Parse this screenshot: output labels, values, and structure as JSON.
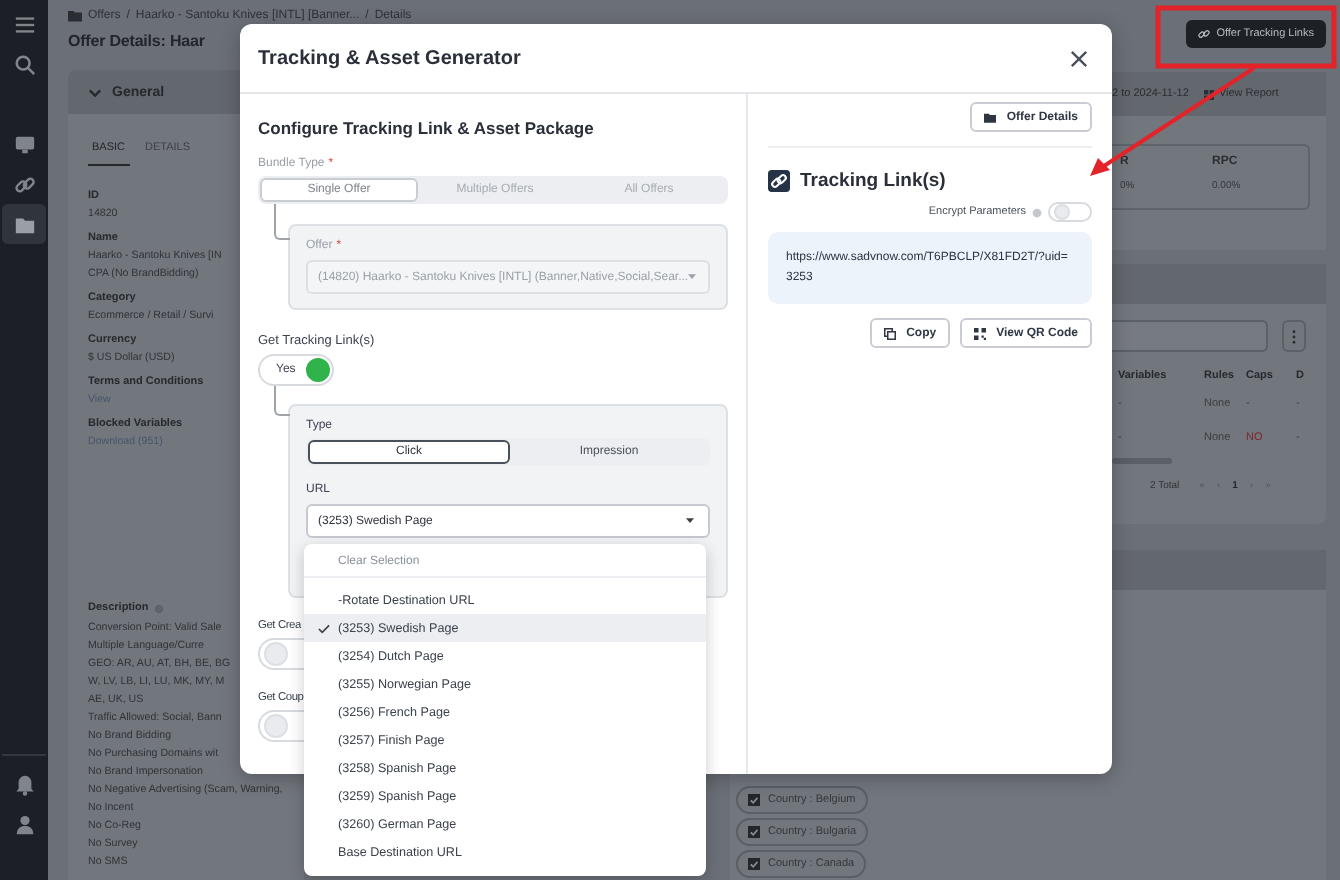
{
  "sidebar": {
    "items": [
      {
        "kind": "menu",
        "selected": false
      },
      {
        "kind": "search",
        "selected": false
      },
      {
        "kind": "monitor",
        "selected": false
      },
      {
        "kind": "link",
        "selected": false
      },
      {
        "kind": "folder",
        "selected": true
      }
    ],
    "bottom_items": [
      {
        "kind": "bell",
        "selected": false
      },
      {
        "kind": "user",
        "selected": false
      }
    ]
  },
  "breadcrumb": [
    "Offers",
    "Haarko - Santoku Knives [INTL] [Banner...",
    "Details"
  ],
  "breadcrumb_separator": "/",
  "page": {
    "title": "Offer Details: Haar",
    "action_button": "Offer Tracking Links",
    "date_range": "2 to 2024-11-12",
    "report_button": "View Report"
  },
  "general": {
    "title": "General",
    "tabs": [
      {
        "label": "BASIC",
        "selected": true
      },
      {
        "label": "DETAILS",
        "selected": false
      }
    ],
    "fields": [
      {
        "label": "ID",
        "values": [
          "14820"
        ],
        "kind": "text"
      },
      {
        "label": "Name",
        "values": [
          "Haarko - Santoku Knives [IN",
          "CPA (No BrandBidding)"
        ],
        "kind": "text"
      },
      {
        "label": "Category",
        "values": [
          "Ecommerce / Retail / Survi"
        ],
        "kind": "text"
      },
      {
        "label": "Currency",
        "values": [
          "$ US Dollar (USD)"
        ],
        "kind": "text"
      },
      {
        "label": "Terms and Conditions",
        "values": [
          "View"
        ],
        "kind": "link"
      },
      {
        "label": "Blocked Variables",
        "values": [
          "Download (951)"
        ],
        "kind": "link"
      }
    ],
    "description": {
      "label": "Description",
      "lines": [
        "Conversion Point: Valid Sale",
        "Multiple Language/Curre",
        "GEO: AR, AU, AT, BH, BE, BG",
        "W, LV, LB, LI, LU, MK, MY, M",
        "AE, UK, US",
        "Traffic Allowed: Social, Bann",
        "No Brand Bidding",
        "No Purchasing Domains wit",
        "No Brand Impersonation",
        "No Negative Advertising (Scam, Warning,",
        "No Incent",
        "No Co-Reg",
        "No Survey",
        "No SMS"
      ]
    }
  },
  "stats": {
    "columns": [
      "R",
      "RPC"
    ],
    "values": [
      "0%",
      "0.00%"
    ]
  },
  "table": {
    "columns": [
      "Variables",
      "Rules",
      "Caps",
      "D"
    ],
    "rows": [
      {
        "cells": [
          "-",
          "None",
          "-",
          "-"
        ],
        "flagged": false
      },
      {
        "cells": [
          "-",
          "None",
          "NO",
          "-"
        ],
        "flagged": true
      }
    ],
    "total": "2 Total",
    "pagination": [
      {
        "label": "«",
        "selected": false
      },
      {
        "label": "‹",
        "selected": false
      },
      {
        "label": "1",
        "selected": true
      },
      {
        "label": "›",
        "selected": false
      },
      {
        "label": "»",
        "selected": false
      }
    ]
  },
  "chips": [
    {
      "label": "Country : Belgium",
      "checked": true
    },
    {
      "label": "Country : Bulgaria",
      "checked": true
    },
    {
      "label": "Country : Canada",
      "checked": true
    }
  ],
  "modal": {
    "title": "Tracking & Asset Generator",
    "required_mark": "*",
    "heading": "Configure Tracking Link & Asset Package",
    "bundle_type": {
      "label": "Bundle Type",
      "required": true,
      "options": [
        {
          "label": "Single Offer",
          "selected": true
        },
        {
          "label": "Multiple Offers",
          "selected": false
        },
        {
          "label": "All Offers",
          "selected": false
        }
      ]
    },
    "offer": {
      "label": "Offer",
      "required": true,
      "value": "(14820) Haarko - Santoku Knives [INTL] (Banner,Native,Social,Sear...",
      "disabled": true
    },
    "tracking_links": {
      "label": "Get Tracking Link(s)",
      "on": true,
      "toggle_text": "Yes"
    },
    "type": {
      "label": "Type",
      "options": [
        {
          "label": "Click",
          "selected": true
        },
        {
          "label": "Impression",
          "selected": false
        }
      ]
    },
    "url": {
      "label": "URL",
      "value": "(3253) Swedish Page"
    },
    "creatives": {
      "label": "Get Crea",
      "on": false
    },
    "coupons": {
      "label": "Get Coup",
      "on": false
    },
    "offer_details_button": "Offer Details",
    "tracking_heading": "Tracking Link(s)",
    "encrypt": {
      "label": "Encrypt Parameters",
      "on": false
    },
    "link": "https://www.sadvnow.com/T6PBCLP/X81FD2T/?uid=3253",
    "buttons": [
      "Copy",
      "View QR Code"
    ]
  },
  "dropdown": {
    "clear": "Clear Selection",
    "options": [
      {
        "label": "-Rotate Destination URL",
        "selected": false
      },
      {
        "label": "(3253) Swedish Page",
        "selected": true
      },
      {
        "label": "(3254) Dutch Page",
        "selected": false
      },
      {
        "label": "(3255) Norwegian Page",
        "selected": false
      },
      {
        "label": "(3256) French Page",
        "selected": false
      },
      {
        "label": "(3257) Finish Page",
        "selected": false
      },
      {
        "label": "(3258) Spanish Page",
        "selected": false
      },
      {
        "label": "(3259) Spanish Page",
        "selected": false
      },
      {
        "label": "(3260) German Page",
        "selected": false
      },
      {
        "label": "Base Destination URL",
        "selected": false
      }
    ]
  }
}
